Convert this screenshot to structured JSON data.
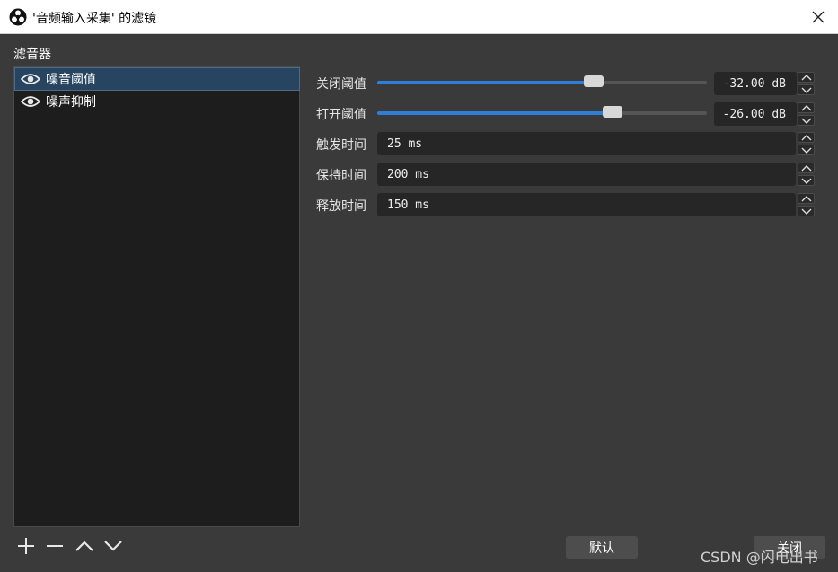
{
  "window": {
    "title": "'音频输入采集' 的滤镜",
    "app_icon": "obs-logo-icon",
    "close_icon": "close-icon"
  },
  "filters_panel": {
    "label": "滤音器",
    "items": [
      {
        "label": "噪音阈值",
        "visible": true,
        "selected": true,
        "icon": "eye-icon"
      },
      {
        "label": "噪声抑制",
        "visible": true,
        "selected": false,
        "icon": "eye-icon"
      }
    ],
    "controls": {
      "add_icon": "plus-icon",
      "remove_icon": "minus-icon",
      "up_icon": "chevron-up-icon",
      "down_icon": "chevron-down-icon"
    }
  },
  "properties": {
    "close_threshold": {
      "label": "关闭阈值",
      "value": "-32.00 dB",
      "level": 0.656
    },
    "open_threshold": {
      "label": "打开阈值",
      "value": "-26.00 dB",
      "level": 0.713
    },
    "attack_time": {
      "label": "触发时间",
      "value": "25 ms"
    },
    "hold_time": {
      "label": "保持时间",
      "value": "200 ms"
    },
    "release_time": {
      "label": "释放时间",
      "value": "150 ms"
    }
  },
  "buttons": {
    "defaults": "默认",
    "close": "关闭"
  },
  "watermark": "CSDN @闪电出书",
  "colors": {
    "background": "#3a3a3a",
    "list_bg": "#1d1d1d",
    "selected_row": "#274560",
    "slider_fill": "#2f7fd9"
  }
}
